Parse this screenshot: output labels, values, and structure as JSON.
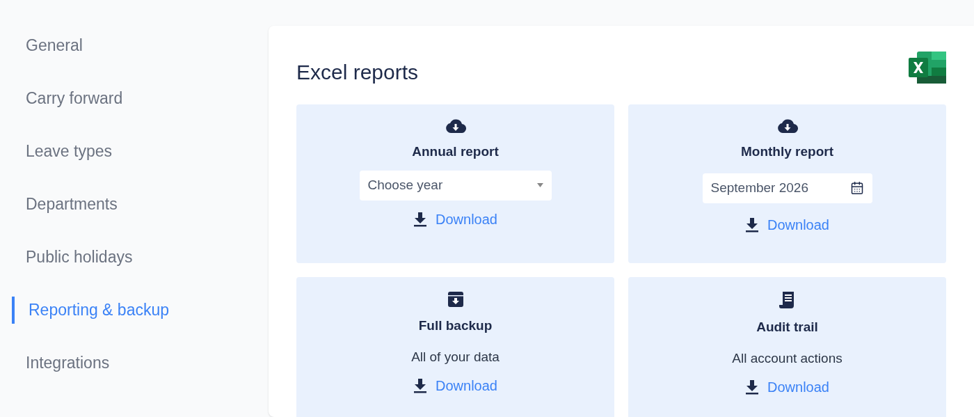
{
  "sidebar": {
    "items": [
      {
        "label": "General",
        "selected": false
      },
      {
        "label": "Carry forward",
        "selected": false
      },
      {
        "label": "Leave types",
        "selected": false
      },
      {
        "label": "Departments",
        "selected": false
      },
      {
        "label": "Public holidays",
        "selected": false
      },
      {
        "label": "Reporting & backup",
        "selected": true
      },
      {
        "label": "Integrations",
        "selected": false
      }
    ]
  },
  "panel": {
    "title": "Excel reports",
    "cards": [
      {
        "kind": "select",
        "title": "Annual report",
        "placeholder": "Choose year",
        "link": "Download"
      },
      {
        "kind": "date",
        "title": "Monthly report",
        "value": "September 2026",
        "link": "Download"
      },
      {
        "kind": "backup",
        "title": "Full backup",
        "description": "All of your data",
        "link": "Download"
      },
      {
        "kind": "audit",
        "title": "Audit trail",
        "description": "All account actions",
        "link": "Download"
      }
    ]
  }
}
